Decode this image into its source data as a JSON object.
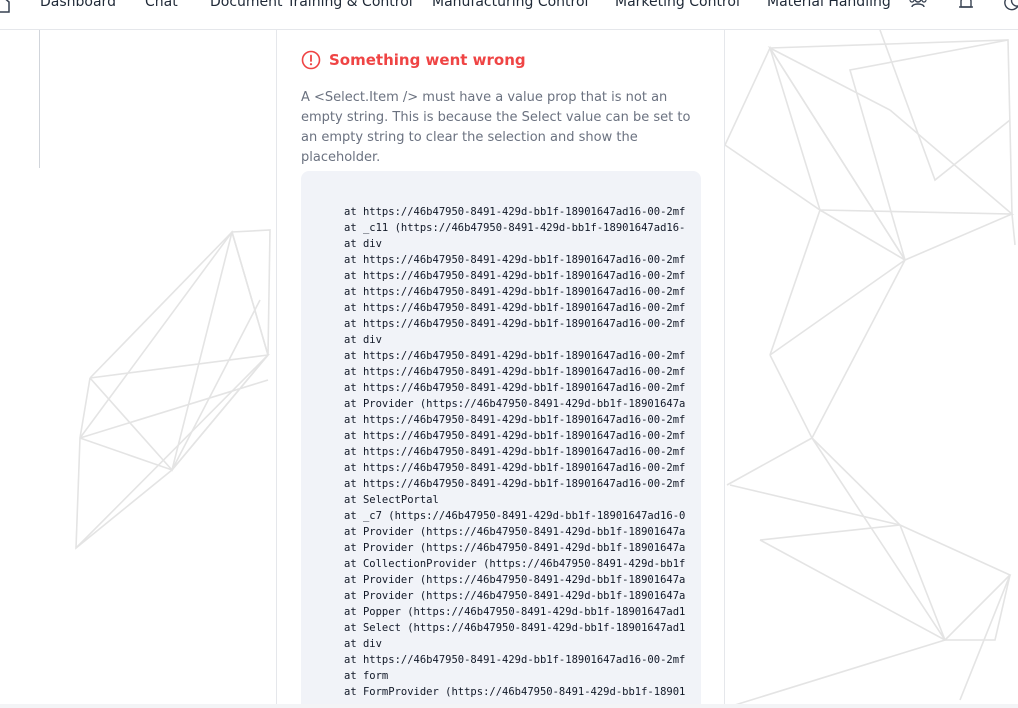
{
  "nav": {
    "items": [
      "Dashboard",
      "Chat",
      "Document Training & Control",
      "Manufacturing Control",
      "Marketing Control",
      "Material Handling"
    ],
    "icons": [
      "home-icon",
      "team-icon",
      "bell-icon",
      "moon-icon"
    ]
  },
  "error": {
    "title": "Something went wrong",
    "message": "A <Select.Item /> must have a value prop that is not an empty string. This is because the Select value can be set to an empty string to clear the selection and show the placeholder.",
    "color": "#ef4444",
    "stack": [
      "at https://46b47950-8491-429d-bb1f-18901647ad16-00-2mf",
      "at _c11 (https://46b47950-8491-429d-bb1f-18901647ad16-",
      "at div",
      "at https://46b47950-8491-429d-bb1f-18901647ad16-00-2mf",
      "at https://46b47950-8491-429d-bb1f-18901647ad16-00-2mf",
      "at https://46b47950-8491-429d-bb1f-18901647ad16-00-2mf",
      "at https://46b47950-8491-429d-bb1f-18901647ad16-00-2mf",
      "at https://46b47950-8491-429d-bb1f-18901647ad16-00-2mf",
      "at div",
      "at https://46b47950-8491-429d-bb1f-18901647ad16-00-2mf",
      "at https://46b47950-8491-429d-bb1f-18901647ad16-00-2mf",
      "at https://46b47950-8491-429d-bb1f-18901647ad16-00-2mf",
      "at Provider (https://46b47950-8491-429d-bb1f-18901647a",
      "at https://46b47950-8491-429d-bb1f-18901647ad16-00-2mf",
      "at https://46b47950-8491-429d-bb1f-18901647ad16-00-2mf",
      "at https://46b47950-8491-429d-bb1f-18901647ad16-00-2mf",
      "at https://46b47950-8491-429d-bb1f-18901647ad16-00-2mf",
      "at https://46b47950-8491-429d-bb1f-18901647ad16-00-2mf",
      "at SelectPortal",
      "at _c7 (https://46b47950-8491-429d-bb1f-18901647ad16-0",
      "at Provider (https://46b47950-8491-429d-bb1f-18901647a",
      "at Provider (https://46b47950-8491-429d-bb1f-18901647a",
      "at CollectionProvider (https://46b47950-8491-429d-bb1f",
      "at Provider (https://46b47950-8491-429d-bb1f-18901647a",
      "at Provider (https://46b47950-8491-429d-bb1f-18901647a",
      "at Popper (https://46b47950-8491-429d-bb1f-18901647ad1",
      "at Select (https://46b47950-8491-429d-bb1f-18901647ad1",
      "at div",
      "at https://46b47950-8491-429d-bb1f-18901647ad16-00-2mf",
      "at form",
      "at FormProvider (https://46b47950-8491-429d-bb1f-18901"
    ]
  }
}
